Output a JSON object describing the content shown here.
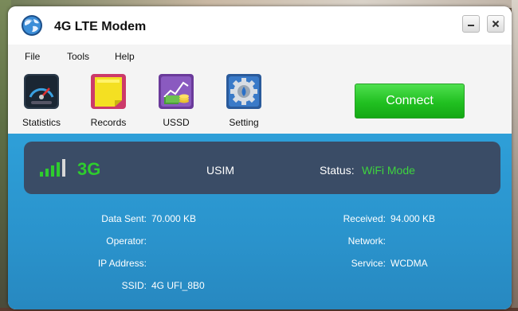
{
  "window": {
    "title": "4G LTE Modem"
  },
  "window_controls": {
    "minimize": "-",
    "close": "✕"
  },
  "menu": [
    "File",
    "Tools",
    "Help"
  ],
  "toolbar": {
    "items": [
      {
        "label": "Statistics",
        "icon": "speedometer-icon"
      },
      {
        "label": "Records",
        "icon": "sticky-note-icon"
      },
      {
        "label": "USSD",
        "icon": "money-chart-icon"
      },
      {
        "label": "Setting",
        "icon": "gear-icon"
      }
    ],
    "connect_label": "Connect"
  },
  "status": {
    "network_type": "3G",
    "sim": "USIM",
    "status_label": "Status:",
    "status_value": "WiFi Mode",
    "signal_bars": 5
  },
  "info": {
    "left": [
      {
        "label": "Data Sent:",
        "value": "70.000 KB"
      },
      {
        "label": "Operator:",
        "value": ""
      },
      {
        "label": "IP Address:",
        "value": ""
      },
      {
        "label": "SSID:",
        "value": "4G UFI_8B0"
      }
    ],
    "right": [
      {
        "label": "Received:",
        "value": "94.000 KB"
      },
      {
        "label": "Network:",
        "value": ""
      },
      {
        "label": "Service:",
        "value": "WCDMA"
      }
    ]
  },
  "colors": {
    "accent_green": "#2ecc2e",
    "panel_blue": "#2a93cc",
    "status_panel": "#3a4c66",
    "connect_green": "#21c021"
  }
}
